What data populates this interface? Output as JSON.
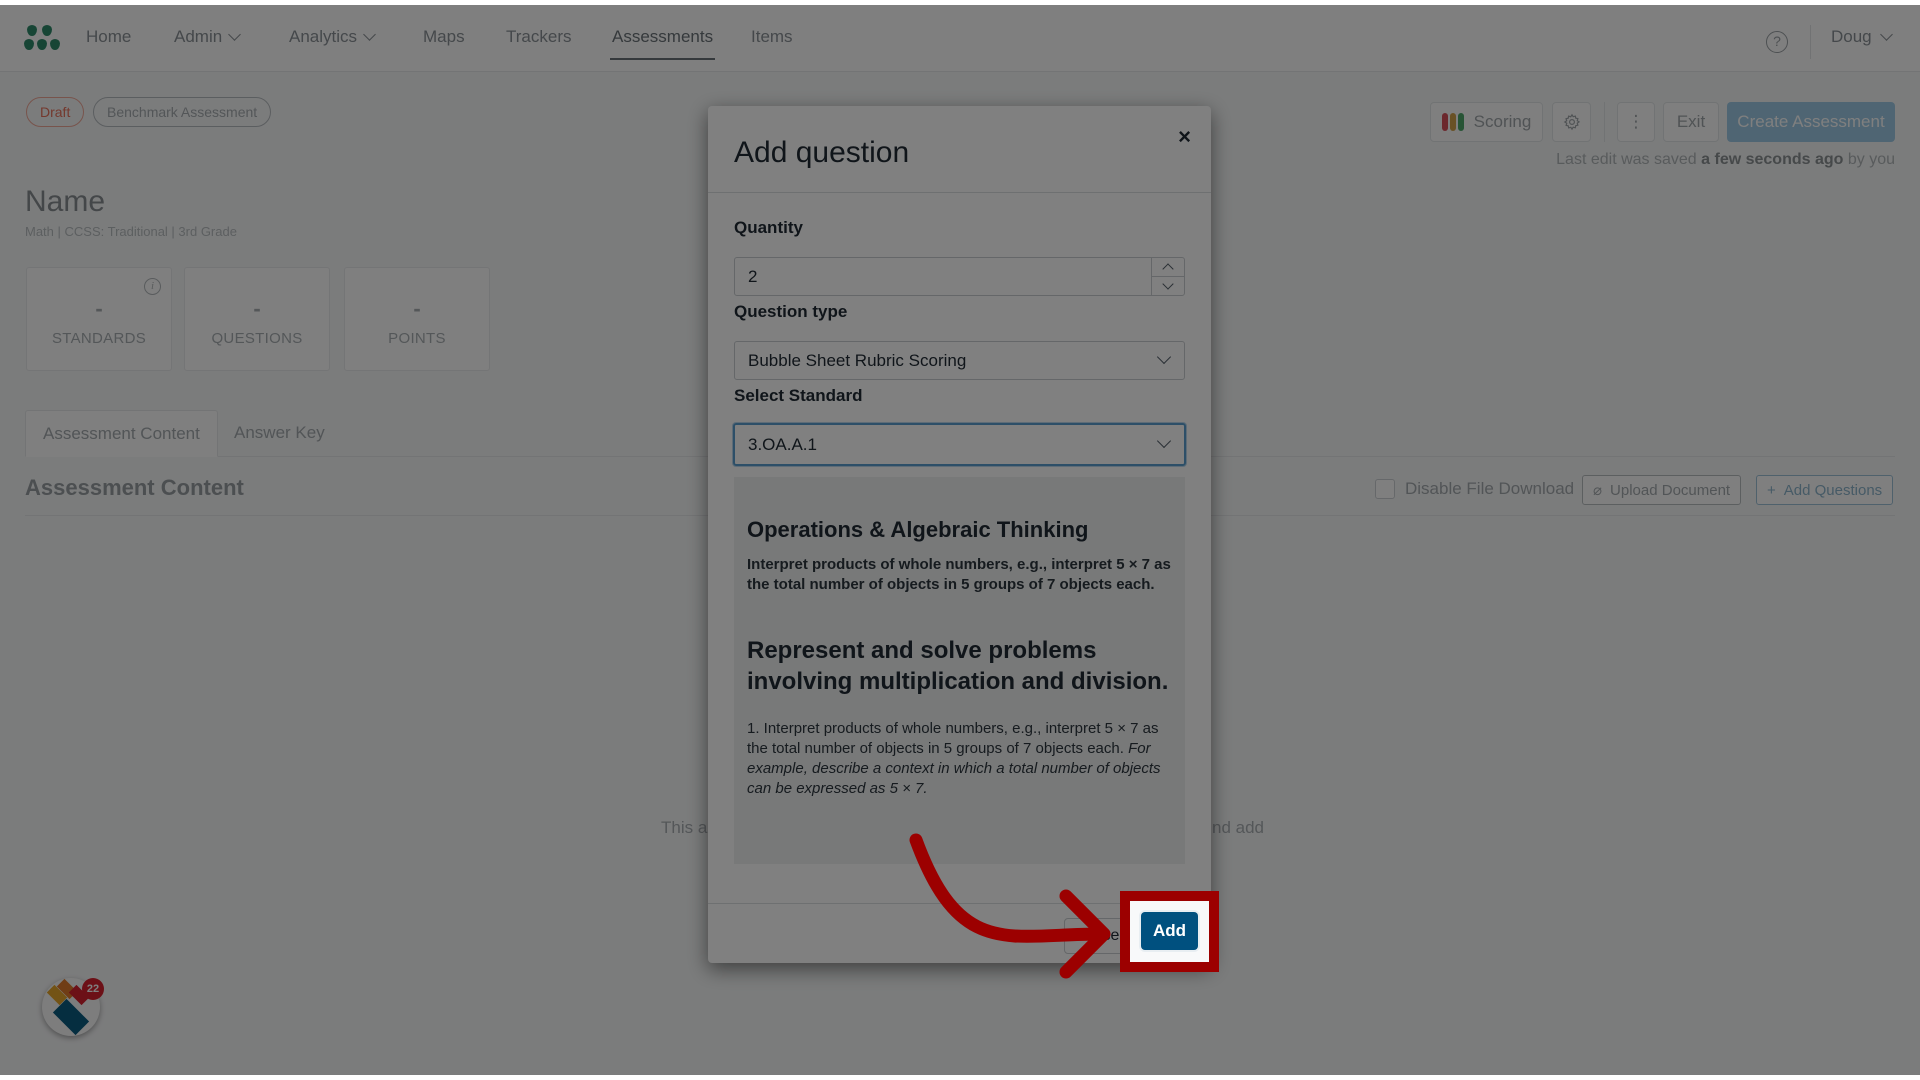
{
  "nav": {
    "items": [
      {
        "label": "Home",
        "dropdown": false
      },
      {
        "label": "Admin",
        "dropdown": true
      },
      {
        "label": "Analytics",
        "dropdown": true
      },
      {
        "label": "Maps",
        "dropdown": false
      },
      {
        "label": "Trackers",
        "dropdown": false
      },
      {
        "label": "Assessments",
        "dropdown": false,
        "active": true
      },
      {
        "label": "Items",
        "dropdown": false
      }
    ],
    "help_icon": "?",
    "user": "Doug"
  },
  "header": {
    "badges": {
      "status": "Draft",
      "type": "Benchmark Assessment"
    },
    "toolbar": {
      "scoring_label": "Scoring",
      "settings_icon": "gear-icon",
      "more_icon": "⋮",
      "exit_label": "Exit",
      "create_label": "Create Assessment"
    },
    "saved_note": {
      "prefix": "Last edit was saved",
      "when": "a few seconds ago",
      "suffix": "by you"
    },
    "title": "Name",
    "subtitle": "Math  |  CCSS: Traditional  |  3rd Grade"
  },
  "stats": [
    {
      "value": "-",
      "label": "STANDARDS",
      "info": true
    },
    {
      "value": "-",
      "label": "QUESTIONS"
    },
    {
      "value": "-",
      "label": "POINTS"
    }
  ],
  "tabs": [
    {
      "label": "Assessment Content",
      "active": true
    },
    {
      "label": "Answer Key"
    }
  ],
  "content": {
    "section_title": "Assessment Content",
    "disable_download_label": "Disable File Download",
    "upload_label": "Upload Document",
    "add_questions_label": "Add Questions",
    "empty_left": "This as",
    "empty_right": "nd add"
  },
  "widget": {
    "notification_count": "22"
  },
  "modal": {
    "title": "Add question",
    "close_icon": "×",
    "quantity_label": "Quantity",
    "quantity_value": "2",
    "question_type_label": "Question type",
    "question_type_value": "Bubble Sheet Rubric Scoring",
    "standard_label": "Select Standard",
    "standard_value": "3.OA.A.1",
    "standard_detail": {
      "domain": "Operations & Algebraic Thinking",
      "summary": "Interpret products of whole numbers, e.g., interpret 5 × 7 as the total number of objects in 5 groups of 7 objects each.",
      "cluster": "Represent and solve problems involving multiplication and division.",
      "standard_text": "1. Interpret products of whole numbers, e.g., interpret 5 × 7 as the total number of objects in 5 groups of 7 objects each.",
      "standard_example": "For example, describe a context in which a total number of objects can be expressed as 5 × 7."
    },
    "close_button_label": "Close",
    "add_button_label": "Add"
  },
  "annotation": {
    "color": "#9c0000",
    "target": "Add"
  }
}
